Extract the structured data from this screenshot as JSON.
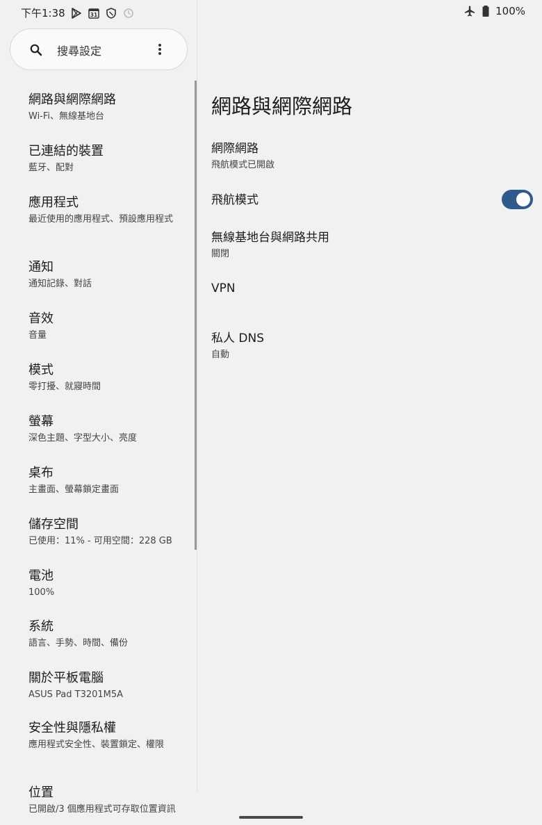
{
  "status_bar": {
    "time": "下午1:38",
    "calendar_day": "31",
    "battery": "100%",
    "icons": [
      "play-store-icon",
      "calendar-icon",
      "shield-icon",
      "sync-icon",
      "airplane-icon",
      "battery-icon"
    ]
  },
  "search": {
    "label": "搜尋設定"
  },
  "menu": [
    {
      "title": "網路與網際網路",
      "subtitle": "Wi-Fi、無線基地台"
    },
    {
      "title": "已連結的裝置",
      "subtitle": "藍牙、配對"
    },
    {
      "title": "應用程式",
      "subtitle": "最近使用的應用程式、預設應用程式"
    },
    {
      "title": "通知",
      "subtitle": "通知記錄、對話"
    },
    {
      "title": "音效",
      "subtitle": "音量"
    },
    {
      "title": "模式",
      "subtitle": "零打擾、就寢時間"
    },
    {
      "title": "螢幕",
      "subtitle": "深色主題、字型大小、亮度"
    },
    {
      "title": "桌布",
      "subtitle": "主畫面、螢幕鎖定畫面"
    },
    {
      "title": "儲存空間",
      "subtitle": "已使用：11% - 可用空間：228 GB"
    },
    {
      "title": "電池",
      "subtitle": "100%"
    },
    {
      "title": "系統",
      "subtitle": "語言、手勢、時間、備份"
    },
    {
      "title": "關於平板電腦",
      "subtitle": "ASUS Pad T3201M5A"
    },
    {
      "title": "安全性與隱私權",
      "subtitle": "應用程式安全性、裝置鎖定、權限"
    },
    {
      "title": "位置",
      "subtitle": "已開啟/3 個應用程式可存取位置資訊"
    }
  ],
  "detail": {
    "title": "網路與網際網路",
    "prefs": [
      {
        "title": "網際網路",
        "subtitle": "飛航模式已開啟"
      },
      {
        "title": "飛航模式",
        "subtitle": ""
      },
      {
        "title": "無線基地台與網路共用",
        "subtitle": "關閉"
      },
      {
        "title": "VPN",
        "subtitle": ""
      },
      {
        "title": "私人 DNS",
        "subtitle": "自動"
      }
    ],
    "airplane_mode_on": true
  },
  "colors": {
    "background": "#f1f1f1",
    "toggle_on": "#2f5a8e",
    "text": "#1c1c1c"
  }
}
